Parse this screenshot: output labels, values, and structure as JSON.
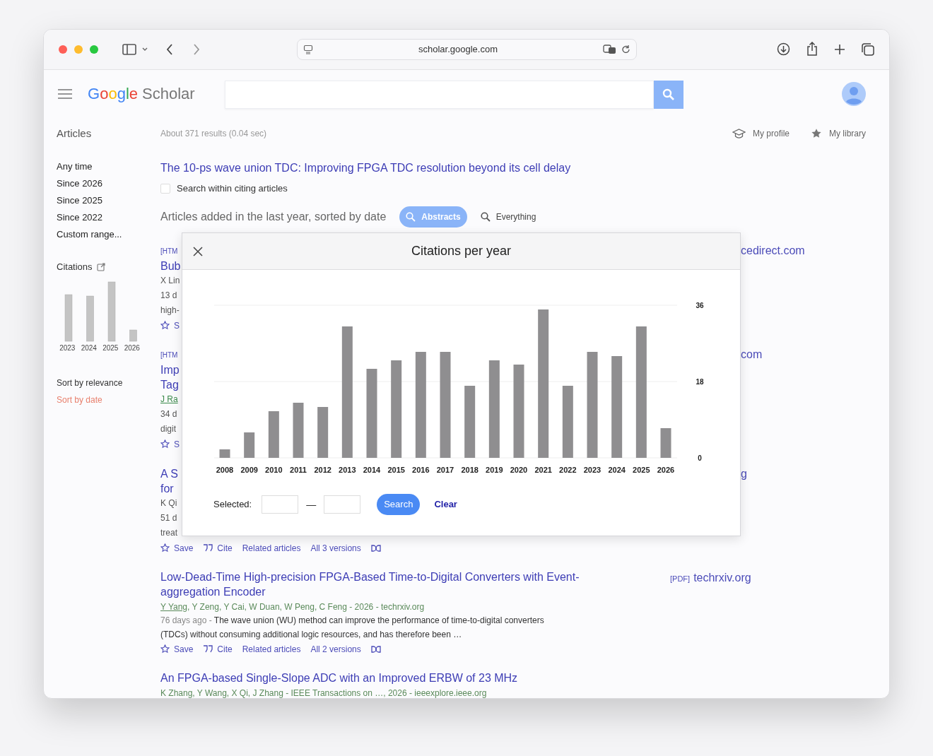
{
  "browser": {
    "url": "scholar.google.com"
  },
  "header": {
    "logo": "Google",
    "product": "Scholar"
  },
  "sidebar": {
    "heading": "Articles",
    "time_filters": [
      "Any time",
      "Since 2026",
      "Since 2025",
      "Since 2022",
      "Custom range..."
    ],
    "citations_label": "Citations",
    "citation_years": [
      "2023",
      "2024",
      "2025",
      "2026"
    ],
    "sort_options": [
      {
        "label": "Sort by relevance",
        "selected": false
      },
      {
        "label": "Sort by date",
        "selected": true
      }
    ]
  },
  "results_info": "About 371 results (0.04 sec)",
  "top_links": [
    {
      "kind": "profile",
      "label": "My profile"
    },
    {
      "kind": "library",
      "label": "My library"
    }
  ],
  "cited_paper": {
    "title": "The 10-ps wave union TDC: Improving FPGA TDC resolution beyond its cell delay",
    "search_within": {
      "label": "Search within citing articles",
      "checked": false
    }
  },
  "alert": {
    "text": "Articles added in the last year, sorted by date",
    "options": [
      {
        "label": "Abstracts",
        "selected": true
      },
      {
        "label": "Everything",
        "selected": false
      }
    ]
  },
  "covered_results": [
    {
      "tag": "[HTM",
      "title_lines": [
        "Bub"
      ],
      "authors": {
        "text": "X Lin",
        "linked": false
      },
      "snippet_lines": [
        "13 d",
        "high-"
      ],
      "action": "S",
      "source": "cedirect.com"
    },
    {
      "tag": "[HTM",
      "title_lines": [
        "Imp",
        "Tag"
      ],
      "authors": {
        "text": "J Ra",
        "linked": true
      },
      "snippet_lines": [
        "34 d",
        "digit"
      ],
      "action": "S",
      "source": "com"
    },
    {
      "title_lines": [
        "A S",
        "for"
      ],
      "authors": {
        "text": "K Qi",
        "linked": false
      },
      "snippet_lines": [
        "51 d",
        "treat"
      ],
      "source": "g",
      "actions": [
        "Save",
        "Cite",
        "Related articles",
        "All 3 versions"
      ]
    }
  ],
  "results": [
    {
      "title": "Low-Dead-Time High-precision FPGA-Based Time-to-Digital Converters with Event-aggregation Encoder",
      "source_tag": "[PDF]",
      "source": "techrxiv.org",
      "linked_author": "Y Yang",
      "authors_rest": ", Y Zeng, Y Cai, W Duan, W Peng, C Feng - 2026 - techrxiv.org",
      "age": "76 days ago - ",
      "snippet": "The wave union (WU) method can improve the performance of time-to-digital converters (TDCs) without consuming additional logic resources, and has therefore been …",
      "actions": [
        "Save",
        "Cite",
        "Related articles",
        "All 2 versions"
      ]
    },
    {
      "title": "An FPGA-based Single-Slope ADC with an Improved ERBW of 23 MHz",
      "authors_rest": "K Zhang, Y Wang, X Qi, J Zhang - IEEE Transactions on …, 2026 - ieeexplore.ieee.org"
    }
  ],
  "modal": {
    "title": "Citations per year",
    "chart_data": {
      "type": "bar",
      "categories": [
        "2008",
        "2009",
        "2010",
        "2011",
        "2012",
        "2013",
        "2014",
        "2015",
        "2016",
        "2017",
        "2018",
        "2019",
        "2020",
        "2021",
        "2022",
        "2023",
        "2024",
        "2025",
        "2026"
      ],
      "values": [
        2,
        6,
        11,
        13,
        12,
        31,
        21,
        23,
        25,
        25,
        17,
        23,
        22,
        35,
        17,
        25,
        24,
        31,
        7
      ],
      "ylim": [
        0,
        36
      ],
      "yticks": [
        0,
        18,
        36
      ]
    },
    "selected_label": "Selected:",
    "dash": "—",
    "buttons": [
      "Search",
      "Clear"
    ]
  }
}
